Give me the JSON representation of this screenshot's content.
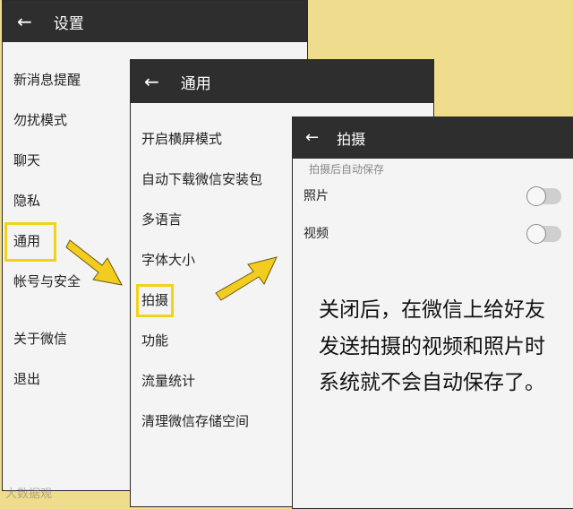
{
  "panel1": {
    "title": "设置",
    "items": [
      "新消息提醒",
      "勿扰模式",
      "聊天",
      "隐私",
      "通用",
      "帐号与安全",
      "关于微信",
      "退出"
    ]
  },
  "panel2": {
    "title": "通用",
    "items": [
      "开启横屏模式",
      "自动下载微信安装包",
      "多语言",
      "字体大小",
      "拍摄",
      "功能",
      "流量统计",
      "清理微信存储空间"
    ]
  },
  "panel3": {
    "title": "拍摄",
    "section": "拍摄后自动保存",
    "options": [
      {
        "label": "照片",
        "on": false
      },
      {
        "label": "视频",
        "on": false
      }
    ]
  },
  "note": {
    "lines": [
      "关闭后，在微信上给好友",
      "发送拍摄的视频和照片时",
      "系统就不会自动保存了。"
    ]
  },
  "watermark": "大数据观",
  "colors": {
    "background": "#efdc8c",
    "bar": "#2e2e2e",
    "highlight": "#f2d21a",
    "arrow": "#f2cc1e"
  }
}
